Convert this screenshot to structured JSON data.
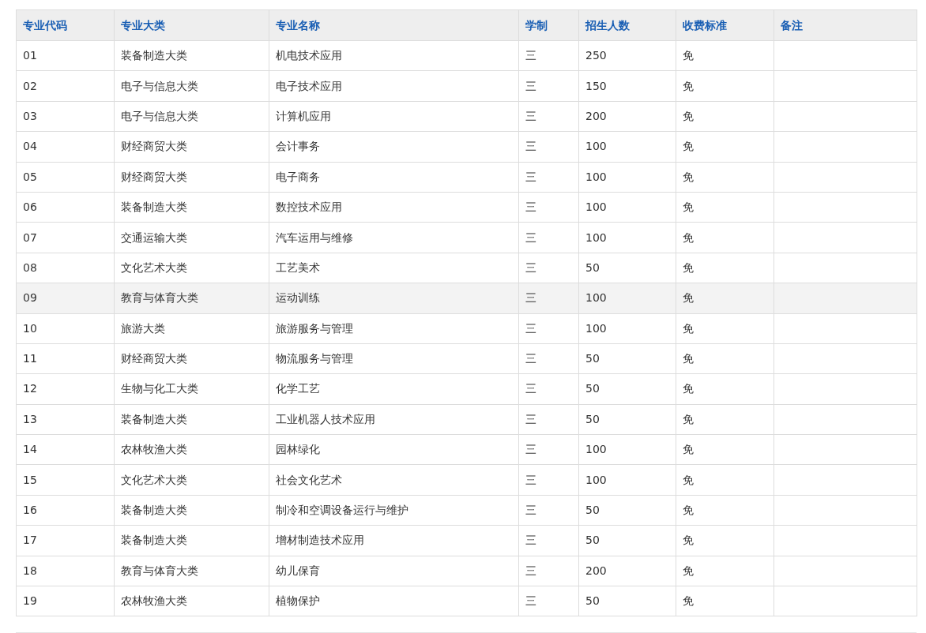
{
  "table": {
    "columns": [
      "专业代码",
      "专业大类",
      "专业名称",
      "学制",
      "招生人数",
      "收费标准",
      "备注"
    ],
    "rows": [
      {
        "cells": [
          "01",
          "装备制造大类",
          "机电技术应用",
          "三",
          "250",
          "免"
        ],
        "highlighted": false
      },
      {
        "cells": [
          "02",
          "电子与信息大类",
          "电子技术应用",
          "三",
          "150",
          "免"
        ],
        "highlighted": false
      },
      {
        "cells": [
          "03",
          "电子与信息大类",
          "计算机应用",
          "三",
          "200",
          "免"
        ],
        "highlighted": false
      },
      {
        "cells": [
          "04",
          "财经商贸大类",
          "会计事务",
          "三",
          "100",
          "免"
        ],
        "highlighted": false
      },
      {
        "cells": [
          "05",
          "财经商贸大类",
          "电子商务",
          "三",
          "100",
          "免"
        ],
        "highlighted": false
      },
      {
        "cells": [
          "06",
          "装备制造大类",
          "数控技术应用",
          "三",
          "100",
          "免"
        ],
        "highlighted": false
      },
      {
        "cells": [
          "07",
          "交通运输大类",
          "汽车运用与维修",
          "三",
          "100",
          "免"
        ],
        "highlighted": false
      },
      {
        "cells": [
          "08",
          "文化艺术大类",
          "工艺美术",
          "三",
          "50",
          "免"
        ],
        "highlighted": false
      },
      {
        "cells": [
          "09",
          "教育与体育大类",
          "运动训练",
          "三",
          "100",
          "免"
        ],
        "highlighted": true
      },
      {
        "cells": [
          "10",
          "旅游大类",
          "旅游服务与管理",
          "三",
          "100",
          "免"
        ],
        "highlighted": false
      },
      {
        "cells": [
          "11",
          "财经商贸大类",
          "物流服务与管理",
          "三",
          "50",
          "免"
        ],
        "highlighted": false
      },
      {
        "cells": [
          "12",
          "生物与化工大类",
          "化学工艺",
          "三",
          "50",
          "免"
        ],
        "highlighted": false
      },
      {
        "cells": [
          "13",
          "装备制造大类",
          "工业机器人技术应用",
          "三",
          "50",
          "免"
        ],
        "highlighted": false
      },
      {
        "cells": [
          "14",
          "农林牧渔大类",
          "园林绿化",
          "三",
          "100",
          "免"
        ],
        "highlighted": false
      },
      {
        "cells": [
          "15",
          "文化艺术大类",
          "社会文化艺术",
          "三",
          "100",
          "免"
        ],
        "highlighted": false
      },
      {
        "cells": [
          "16",
          "装备制造大类",
          "制冷和空调设备运行与维护",
          "三",
          "50",
          "免"
        ],
        "highlighted": false
      },
      {
        "cells": [
          "17",
          "装备制造大类",
          "增材制造技术应用",
          "三",
          "50",
          "免"
        ],
        "highlighted": false
      },
      {
        "cells": [
          "18",
          "教育与体育大类",
          "幼儿保育",
          "三",
          "200",
          "免"
        ],
        "highlighted": false
      },
      {
        "cells": [
          "19",
          "农林牧渔大类",
          "植物保护",
          "三",
          "50",
          "免"
        ],
        "highlighted": false
      }
    ]
  }
}
